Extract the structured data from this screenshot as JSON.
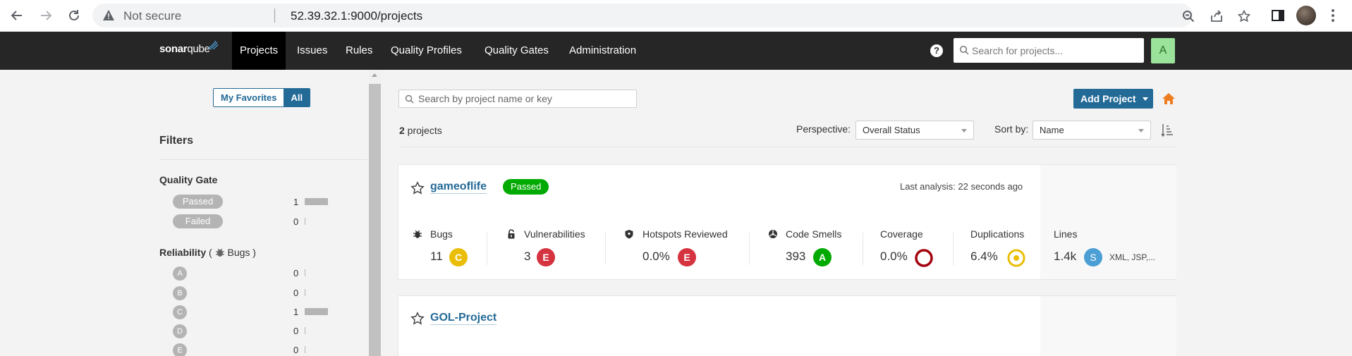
{
  "browser": {
    "security_label": "Not secure",
    "url": "52.39.32.1:9000/projects"
  },
  "app": {
    "logo_bold": "sonar",
    "logo_light": "qube",
    "nav": [
      "Projects",
      "Issues",
      "Rules",
      "Quality Profiles",
      "Quality Gates",
      "Administration"
    ],
    "search_placeholder": "Search for projects...",
    "user_initial": "A",
    "help_glyph": "?"
  },
  "sidebar": {
    "toggle": {
      "favorites": "My Favorites",
      "all": "All"
    },
    "filters_title": "Filters",
    "quality_gate": {
      "title": "Quality Gate",
      "items": [
        {
          "label": "Passed",
          "count": "1"
        },
        {
          "label": "Failed",
          "count": "0"
        }
      ]
    },
    "reliability": {
      "title": "Reliability",
      "paren_open": "(",
      "sub": "Bugs",
      "paren_close": ")",
      "items": [
        {
          "label": "A",
          "count": "0"
        },
        {
          "label": "B",
          "count": "0"
        },
        {
          "label": "C",
          "count": "1"
        },
        {
          "label": "D",
          "count": "0"
        },
        {
          "label": "E",
          "count": "0"
        }
      ]
    }
  },
  "main": {
    "search_placeholder": "Search by project name or key",
    "add_project": "Add Project",
    "project_count": "2",
    "project_count_suffix": " projects",
    "perspective_label": "Perspective:",
    "perspective_value": "Overall Status",
    "sort_label": "Sort by:",
    "sort_value": "Name"
  },
  "projects": [
    {
      "name": "gameoflife",
      "status": "Passed",
      "last_analysis": "Last analysis: 22 seconds ago",
      "metrics": {
        "bugs": {
          "label": "Bugs",
          "value": "11",
          "rating": "C"
        },
        "vulnerabilities": {
          "label": "Vulnerabilities",
          "value": "3",
          "rating": "E"
        },
        "hotspots": {
          "label": "Hotspots Reviewed",
          "value": "0.0%",
          "rating": "E"
        },
        "code_smells": {
          "label": "Code Smells",
          "value": "393",
          "rating": "A"
        },
        "coverage": {
          "label": "Coverage",
          "value": "0.0%"
        },
        "duplications": {
          "label": "Duplications",
          "value": "6.4%"
        },
        "lines": {
          "label": "Lines",
          "value": "1.4k",
          "size": "S",
          "languages": "XML, JSP,..."
        }
      }
    },
    {
      "name": "GOL-Project"
    }
  ],
  "colors": {
    "nav_bg": "#262626",
    "primary": "#236a97",
    "passed": "#00aa00",
    "rating_a": "#00aa00",
    "rating_c": "#eabe06",
    "rating_e": "#d4333f",
    "size_s": "#4b9fd5",
    "coverage_ring": "#a4030f",
    "duplication_ring": "#eabe06",
    "home": "#ed7d20"
  }
}
